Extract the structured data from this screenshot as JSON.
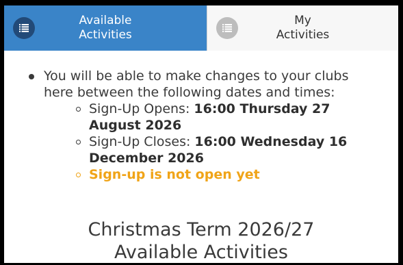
{
  "tabs": [
    {
      "label": "Available\nActivities",
      "icon": "list-icon",
      "active": true
    },
    {
      "label": "My\nActivities",
      "icon": "list-icon",
      "active": false
    }
  ],
  "info": {
    "intro": "You will be able to make changes to your clubs here between the following dates and times:",
    "signup_opens_label": "Sign-Up Opens: ",
    "signup_opens_value": "16:00 Thursday 27 August 2026",
    "signup_closes_label": "Sign-Up Closes: ",
    "signup_closes_value": "16:00 Wednesday 16 December 2026",
    "status": "Sign-up is not open yet"
  },
  "headings": {
    "line1": "Christmas Term 2026/27",
    "line2": "Available Activities"
  },
  "colors": {
    "active_tab": "#3a84c8",
    "active_icon_bg": "#224a78",
    "inactive_icon_bg": "#bdbdbd",
    "warning": "#f0a418"
  }
}
